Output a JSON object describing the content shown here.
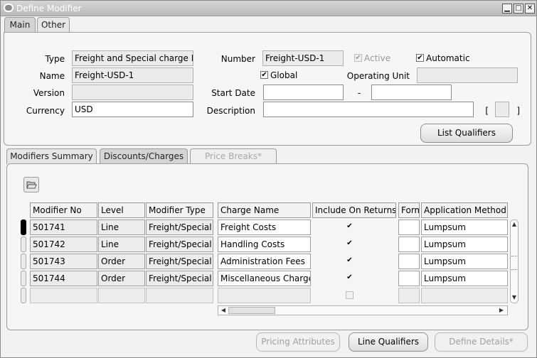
{
  "window": {
    "title": "Define Modifier",
    "controls": {
      "minimize": "▁",
      "maximize": "□",
      "close": "✕"
    }
  },
  "top_tabs": [
    {
      "label": "Main",
      "active": true
    },
    {
      "label": "Other",
      "active": false
    }
  ],
  "header": {
    "type_label": "Type",
    "type_value": "Freight and Special charge Li",
    "number_label": "Number",
    "number_value": "Freight-USD-1",
    "active_label": "Active",
    "active_checked": true,
    "automatic_label": "Automatic",
    "automatic_checked": true,
    "name_label": "Name",
    "name_value": "Freight-USD-1",
    "global_label": "Global",
    "global_checked": true,
    "operating_unit_label": "Operating Unit",
    "operating_unit_value": "",
    "version_label": "Version",
    "version_value": "",
    "start_date_label": "Start Date",
    "start_date_value": "",
    "date_separator": "-",
    "end_date_value": "",
    "currency_label": "Currency",
    "currency_value": "USD",
    "description_label": "Description",
    "description_value": "",
    "flex_open": "[",
    "flex_close": "]",
    "list_qualifiers_button": "List Qualifiers"
  },
  "lower_tabs": [
    {
      "label": "Modifiers Summary",
      "state": "normal"
    },
    {
      "label": "Discounts/Charges",
      "state": "active"
    },
    {
      "label": "Price Breaks*",
      "state": "disabled"
    }
  ],
  "grid": {
    "columns": {
      "modifier_no": "Modifier No",
      "level": "Level",
      "modifier_type": "Modifier Type",
      "charge_name": "Charge Name",
      "include_on_returns": "Include On Returns",
      "formula": "Form",
      "application_method": "Application Method"
    },
    "rows": [
      {
        "modifier_no": "501741",
        "level": "Line",
        "modifier_type": "Freight/Special",
        "charge_name": "Freight Costs",
        "include_on_returns": true,
        "formula": "",
        "application_method": "Lumpsum"
      },
      {
        "modifier_no": "501742",
        "level": "Line",
        "modifier_type": "Freight/Special",
        "charge_name": "Handling Costs",
        "include_on_returns": true,
        "formula": "",
        "application_method": "Lumpsum"
      },
      {
        "modifier_no": "501743",
        "level": "Order",
        "modifier_type": "Freight/Special",
        "charge_name": "Administration Fees",
        "include_on_returns": true,
        "formula": "",
        "application_method": "Lumpsum"
      },
      {
        "modifier_no": "501744",
        "level": "Order",
        "modifier_type": "Freight/Special",
        "charge_name": "Miscellaneous Charge",
        "include_on_returns": true,
        "formula": "",
        "application_method": "Lumpsum"
      },
      {
        "modifier_no": "",
        "level": "",
        "modifier_type": "",
        "charge_name": "",
        "include_on_returns": false,
        "formula": "",
        "application_method": ""
      }
    ]
  },
  "footer_buttons": {
    "pricing_attributes": "Pricing Attributes",
    "line_qualifiers": "Line Qualifiers",
    "define_details": "Define Details*"
  },
  "icons": {
    "folder_tool": "folder-open-icon",
    "check": "✔"
  }
}
